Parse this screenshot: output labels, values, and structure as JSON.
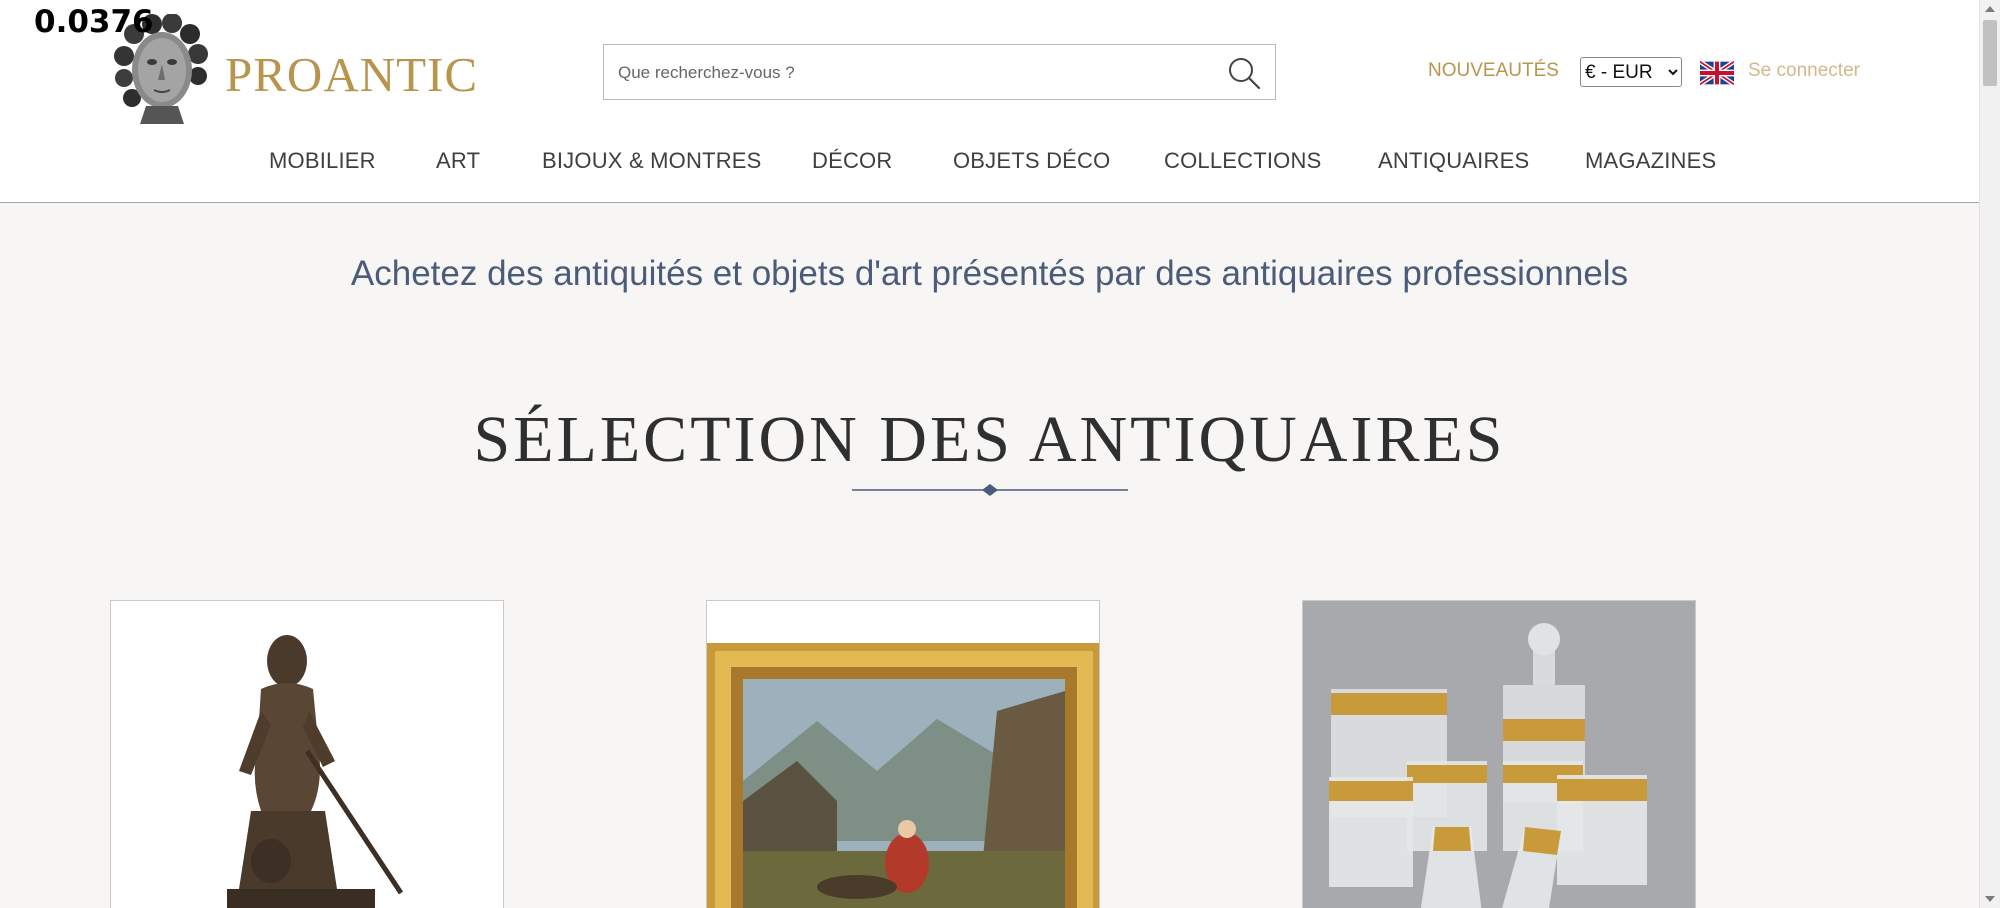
{
  "debug": {
    "label": "0.0376"
  },
  "brand": {
    "name": "PROANTIC",
    "logo_icon": "sculpted-head-logo-icon",
    "gold": "#b8954f"
  },
  "search": {
    "placeholder": "Que recherchez-vous ?",
    "value": "",
    "icon": "search-icon"
  },
  "header": {
    "nouveautes": "NOUVEAUTÉS",
    "currency": {
      "selected": "€ - EUR",
      "options": [
        "€ - EUR"
      ]
    },
    "language_flag": "uk-flag-icon",
    "login": "Se connecter"
  },
  "nav": {
    "items": [
      {
        "label": "MOBILIER"
      },
      {
        "label": "ART"
      },
      {
        "label": "BIJOUX & MONTRES"
      },
      {
        "label": "DÉCOR"
      },
      {
        "label": "OBJETS DÉCO"
      },
      {
        "label": "COLLECTIONS"
      },
      {
        "label": "ANTIQUAIRES"
      },
      {
        "label": "MAGAZINES"
      }
    ]
  },
  "main": {
    "tagline": "Achetez des antiquités et objets d'art présentés par des antiquaires professionnels",
    "section_title": "SÉLECTION DES ANTIQUAIRES",
    "accent": "#4a5c7a",
    "products": [
      {
        "image": "bronze-statue-image"
      },
      {
        "image": "gilt-framed-painting-image"
      },
      {
        "image": "gilded-crystal-glassware-image"
      }
    ]
  }
}
